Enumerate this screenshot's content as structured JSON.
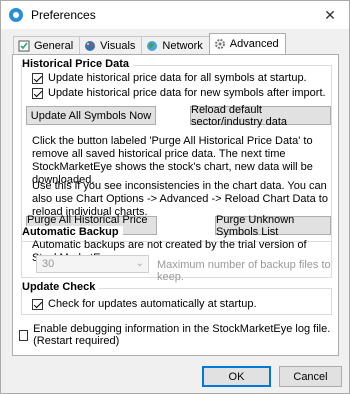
{
  "window": {
    "title": "Preferences"
  },
  "tabs": [
    {
      "label": "General"
    },
    {
      "label": "Visuals"
    },
    {
      "label": "Network"
    },
    {
      "label": "Advanced"
    }
  ],
  "historical": {
    "title": "Historical Price Data",
    "cb1": "Update historical price data for all symbols at startup.",
    "cb2": "Update historical price data for new symbols after import.",
    "btn_update": "Update All Symbols Now",
    "btn_reload": "Reload default sector/industry data",
    "para1": "Click the button labeled 'Purge All Historical Price Data' to remove all saved historical price data. The next time StockMarketEye shows the stock's chart, new data will be downloaded.",
    "para2": "Use this if you see inconsistencies in the chart data. You can also use Chart Options -> Advanced -> Reload Chart Data to reload individual charts.",
    "btn_purge_all": "Purge All Historical Price Data",
    "btn_purge_unknown": "Purge Unknown Symbols List"
  },
  "backup": {
    "title": "Automatic Backup",
    "note": "Automatic backups are not created by the trial version of StockMarketEye.",
    "max_files_value": "30",
    "max_files_label": "Maximum number of backup files to keep."
  },
  "update": {
    "title": "Update Check",
    "cb": "Check for updates automatically at startup."
  },
  "debug_cb": "Enable debugging information in the StockMarketEye log file. (Restart required)",
  "buttons": {
    "ok": "OK",
    "cancel": "Cancel"
  }
}
